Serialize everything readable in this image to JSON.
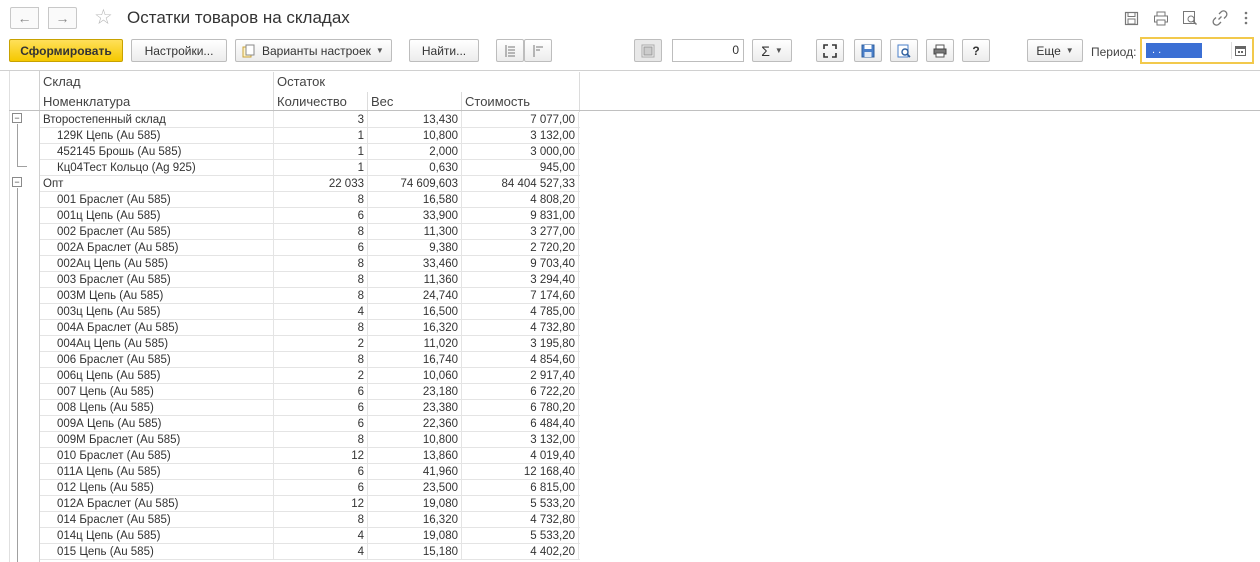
{
  "header": {
    "title": "Остатки товаров на складах",
    "back_icon": "←",
    "forward_icon": "→"
  },
  "toolbar": {
    "generate_label": "Сформировать",
    "settings_label": "Настройки...",
    "variants_label": "Варианты настроек",
    "find_label": "Найти...",
    "number_value": "0",
    "sum_label": "Σ",
    "more_label": "Еще",
    "period_label": "Период:",
    "period_value": ". ."
  },
  "colors": {
    "primary_button": "#f5c800",
    "period_border": "#f2c94c",
    "selection": "#3b6fd4"
  },
  "table": {
    "header_group_warehouse": "Склад",
    "header_group_balance": "Остаток",
    "header_item": "Номенклатура",
    "header_qty": "Количество",
    "header_weight": "Вес",
    "header_cost": "Стоимость",
    "rows": [
      {
        "level": 0,
        "name": "Второстепенный склад",
        "qty": "3",
        "weight": "13,430",
        "cost": "7 077,00"
      },
      {
        "level": 1,
        "name": "129К Цепь (Au 585)",
        "qty": "1",
        "weight": "10,800",
        "cost": "3 132,00"
      },
      {
        "level": 1,
        "name": "452145 Брошь (Au 585)",
        "qty": "1",
        "weight": "2,000",
        "cost": "3 000,00"
      },
      {
        "level": 1,
        "name": "Кц04Тест Кольцо (Ag 925)",
        "qty": "1",
        "weight": "0,630",
        "cost": "945,00"
      },
      {
        "level": 0,
        "name": "Опт",
        "qty": "22 033",
        "weight": "74 609,603",
        "cost": "84 404 527,33"
      },
      {
        "level": 1,
        "name": "001 Браслет (Au 585)",
        "qty": "8",
        "weight": "16,580",
        "cost": "4 808,20"
      },
      {
        "level": 1,
        "name": "001ц Цепь (Au 585)",
        "qty": "6",
        "weight": "33,900",
        "cost": "9 831,00"
      },
      {
        "level": 1,
        "name": "002 Браслет (Au 585)",
        "qty": "8",
        "weight": "11,300",
        "cost": "3 277,00"
      },
      {
        "level": 1,
        "name": "002А Браслет (Au 585)",
        "qty": "6",
        "weight": "9,380",
        "cost": "2 720,20"
      },
      {
        "level": 1,
        "name": "002Ац Цепь (Au 585)",
        "qty": "8",
        "weight": "33,460",
        "cost": "9 703,40"
      },
      {
        "level": 1,
        "name": "003 Браслет (Au 585)",
        "qty": "8",
        "weight": "11,360",
        "cost": "3 294,40"
      },
      {
        "level": 1,
        "name": "003М Цепь (Au 585)",
        "qty": "8",
        "weight": "24,740",
        "cost": "7 174,60"
      },
      {
        "level": 1,
        "name": "003ц Цепь (Au 585)",
        "qty": "4",
        "weight": "16,500",
        "cost": "4 785,00"
      },
      {
        "level": 1,
        "name": "004А Браслет (Au 585)",
        "qty": "8",
        "weight": "16,320",
        "cost": "4 732,80"
      },
      {
        "level": 1,
        "name": "004Ац Цепь (Au 585)",
        "qty": "2",
        "weight": "11,020",
        "cost": "3 195,80"
      },
      {
        "level": 1,
        "name": "006 Браслет (Au 585)",
        "qty": "8",
        "weight": "16,740",
        "cost": "4 854,60"
      },
      {
        "level": 1,
        "name": "006ц Цепь (Au 585)",
        "qty": "2",
        "weight": "10,060",
        "cost": "2 917,40"
      },
      {
        "level": 1,
        "name": "007 Цепь (Au 585)",
        "qty": "6",
        "weight": "23,180",
        "cost": "6 722,20"
      },
      {
        "level": 1,
        "name": "008 Цепь (Au 585)",
        "qty": "6",
        "weight": "23,380",
        "cost": "6 780,20"
      },
      {
        "level": 1,
        "name": "009А Цепь (Au 585)",
        "qty": "6",
        "weight": "22,360",
        "cost": "6 484,40"
      },
      {
        "level": 1,
        "name": "009М Браслет (Au 585)",
        "qty": "8",
        "weight": "10,800",
        "cost": "3 132,00"
      },
      {
        "level": 1,
        "name": "010 Браслет (Au 585)",
        "qty": "12",
        "weight": "13,860",
        "cost": "4 019,40"
      },
      {
        "level": 1,
        "name": "011А Цепь (Au 585)",
        "qty": "6",
        "weight": "41,960",
        "cost": "12 168,40"
      },
      {
        "level": 1,
        "name": "012 Цепь (Au 585)",
        "qty": "6",
        "weight": "23,500",
        "cost": "6 815,00"
      },
      {
        "level": 1,
        "name": "012А Браслет (Au 585)",
        "qty": "12",
        "weight": "19,080",
        "cost": "5 533,20"
      },
      {
        "level": 1,
        "name": "014 Браслет (Au 585)",
        "qty": "8",
        "weight": "16,320",
        "cost": "4 732,80"
      },
      {
        "level": 1,
        "name": "014ц Цепь (Au 585)",
        "qty": "4",
        "weight": "19,080",
        "cost": "5 533,20"
      },
      {
        "level": 1,
        "name": "015 Цепь (Au 585)",
        "qty": "4",
        "weight": "15,180",
        "cost": "4 402,20"
      }
    ]
  }
}
